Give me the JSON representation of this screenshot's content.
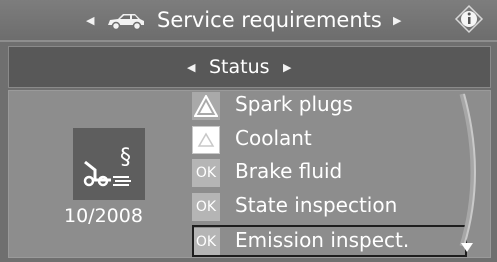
{
  "header": {
    "title": "Service requirements",
    "left_icon": "car-icon",
    "right_icon": "info-icon"
  },
  "subheader": {
    "title": "Status"
  },
  "summary": {
    "icon": "service-symbol-icon",
    "date": "10/2008"
  },
  "items": [
    {
      "badge": "warning-triangle",
      "label": "Spark plugs"
    },
    {
      "badge": "triangle-outline",
      "label": "Coolant"
    },
    {
      "badge": "OK",
      "label": "Brake fluid"
    },
    {
      "badge": "OK",
      "label": "State inspection"
    },
    {
      "badge": "OK",
      "label": "Emission inspect."
    }
  ],
  "colors": {
    "background": "#6f6f6f",
    "panel": "#8d8d8d",
    "ok_badge": "#b5b5b5",
    "text": "#ffffff"
  }
}
